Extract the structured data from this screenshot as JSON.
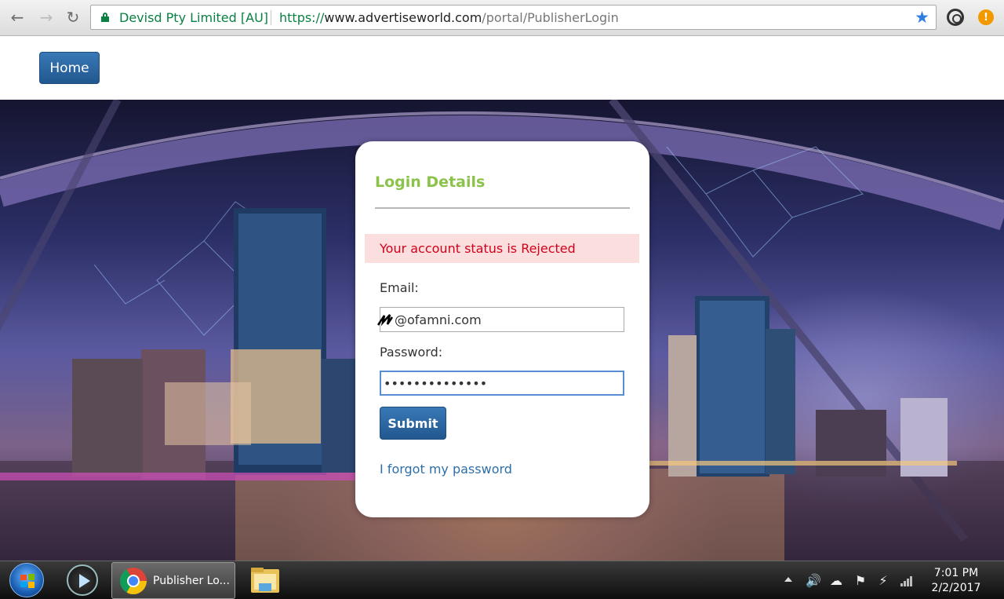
{
  "browser": {
    "ev_name": "Devisd Pty Limited [AU]",
    "url_protocol": "https://",
    "url_host": "www.advertiseworld.com",
    "url_path": "/portal/PublisherLogin",
    "alert_badge": "!"
  },
  "header": {
    "home_label": "Home"
  },
  "login": {
    "title": "Login Details",
    "status_message": "Your account status is Rejected",
    "email_label": "Email:",
    "email_value": "@ofamni.com",
    "password_label": "Password:",
    "password_value": "••••••••••••••",
    "submit_label": "Submit",
    "forgot_label": "I forgot my password"
  },
  "taskbar": {
    "chrome_label": "Publisher Lo...",
    "time": "7:01 PM",
    "date": "2/2/2017"
  },
  "colors": {
    "accent_green": "#8bc34a",
    "button_blue": "#2a67a3",
    "error_red": "#d0021b",
    "error_bg": "#fbdede"
  }
}
